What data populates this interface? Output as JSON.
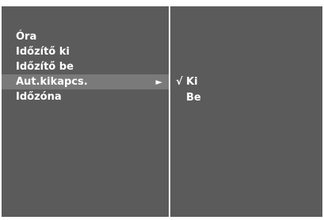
{
  "menu": {
    "items": [
      {
        "label": "Óra"
      },
      {
        "label": "Időzítő ki"
      },
      {
        "label": "Időzítő be"
      },
      {
        "label": "Aut.kikapcs."
      },
      {
        "label": "Időzóna"
      }
    ],
    "selected_arrow": "►"
  },
  "submenu": {
    "check_mark": "√",
    "options": [
      {
        "label": "Ki",
        "checked": true
      },
      {
        "label": "Be",
        "checked": false
      }
    ]
  },
  "colors": {
    "panel_bg": "#5b5b5b",
    "highlight_bg": "#7a7a7a",
    "text": "#ffffff",
    "divider": "#ffffff"
  }
}
